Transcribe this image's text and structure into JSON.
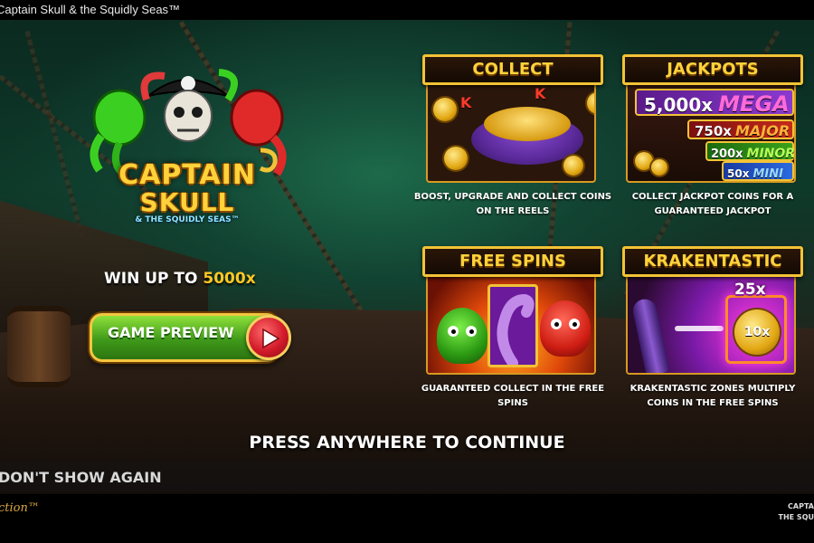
{
  "window": {
    "title": "Captain Skull & the Squidly Seas™"
  },
  "logo": {
    "line1": "CAPTAIN",
    "line2": "SKULL",
    "line3": "& THE SQUIDLY SEAS™"
  },
  "promo": {
    "win_prefix": "WIN UP TO ",
    "win_amount": "5000x"
  },
  "preview_button": {
    "label": "GAME PREVIEW",
    "icon": "play-icon"
  },
  "features": [
    {
      "title": "COLLECT",
      "description": "BOOST, UPGRADE AND COLLECT COINS ON THE REELS",
      "art_letters": [
        "K",
        "K"
      ]
    },
    {
      "title": "JACKPOTS",
      "description": "COLLECT JACKPOT COINS FOR A GUARANTEED JACKPOT",
      "tiers": [
        {
          "multiplier": "5,000x",
          "name": "MEGA",
          "color": "#ff6ad8"
        },
        {
          "multiplier": "750x",
          "name": "MAJOR",
          "color": "#ffb23a"
        },
        {
          "multiplier": "200x",
          "name": "MINOR",
          "color": "#b6ff5a"
        },
        {
          "multiplier": "50x",
          "name": "MINI",
          "color": "#9ad8ff"
        }
      ]
    },
    {
      "title": "FREE SPINS",
      "description": "GUARANTEED COLLECT IN THE FREE SPINS"
    },
    {
      "title": "KRAKENTASTIC",
      "description": "KRAKENTASTIC ZONES MULTIPLY COINS IN THE FREE SPINS",
      "zone_multiplier": "25x",
      "coin_value": "10x"
    }
  ],
  "press_continue": "PRESS ANYWHERE TO CONTINUE",
  "dont_show_again": "DON'T SHOW AGAIN",
  "footer": {
    "left_brand": "ction™",
    "right_title": "CAPTA\nTHE SQU"
  },
  "colors": {
    "accent_gold": "#f2c336",
    "title_gold": "#ffd23a",
    "button_green": "#3f9a1a",
    "play_red": "#d21b2a"
  }
}
